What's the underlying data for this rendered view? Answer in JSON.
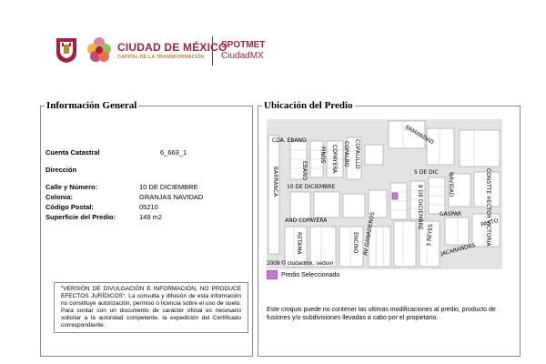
{
  "header": {
    "brand_title": "CIUDAD DE MÉXICO",
    "brand_subtitle": "CAPITAL DE LA TRANSFORMACIÓN",
    "app_title": "SPOTMET",
    "app_subtitle": "CiudadMX",
    "brand_color": "#9f2241",
    "accent_color": "#b8862b"
  },
  "info": {
    "legend": "Información General",
    "cuenta_label": "Cuenta Catastral",
    "cuenta_value": "6_663_1",
    "direccion_label": "Dirección",
    "calle_label": "Calle y Número:",
    "calle_value": "10 DE DICIEMBRE",
    "colonia_label": "Colonia:",
    "colonia_value": "GRANJAS NAVIDAD",
    "cp_label": "Código Postal:",
    "cp_value": "05210",
    "superficie_label": "Superficie del Predio:",
    "superficie_value": "149 m2",
    "notice": "\"VERSIÓN DE DIVULGACIÓN E INFORMACIÓN, NO PRODUCE EFECTOS JURÍDICOS\". La consulta y difusión de esta información no constituye autorización, permiso o licencia sobre el uso de suelo. Para contar con un documento de carácter oficial es necesario solicitar a la autoridad competente, la expedición del Certificado correspondiente."
  },
  "map": {
    "legend": "Ubicación del Predio",
    "credit": "2009 © ciudadmx, seduvi",
    "legend_label": "Predio Seleccionado",
    "highlight_color": "#c97bd1",
    "note": "Este croquis puede no contener las ultimas modificaciones al predio, producto de fusiones y/o subdivisiones llevadas a cabo por el propietario.",
    "street_labels": {
      "ermandad": "ERMANDAD",
      "cda_ebano": "CDA. EBANO",
      "pinos": "PINOS",
      "copayera": "COPAYERA",
      "copalbo": "COPALBO",
      "copalillo": "COPALILLO",
      "barranca": "BARRANCA",
      "ebano": "EBANO",
      "cinco_dic": "5 DE DIC",
      "diez_dic": "10 DE DICIEMBRE",
      "navidad": "NAVIDAD",
      "ocho_dic": "8 DE DICIEMBRE",
      "and_copayera": "AND COPAYERA",
      "gaspar": "GASPAR",
      "const": "CONSTTE HECTOR VICTORIA",
      "av_ganaderos": "AV GANADEROS",
      "tres_reyes": "3 REYES",
      "pasto": "PASTO",
      "jacarandas": "JACARANDAS",
      "retama": "RETAMA",
      "encino": "ENCINO"
    }
  }
}
